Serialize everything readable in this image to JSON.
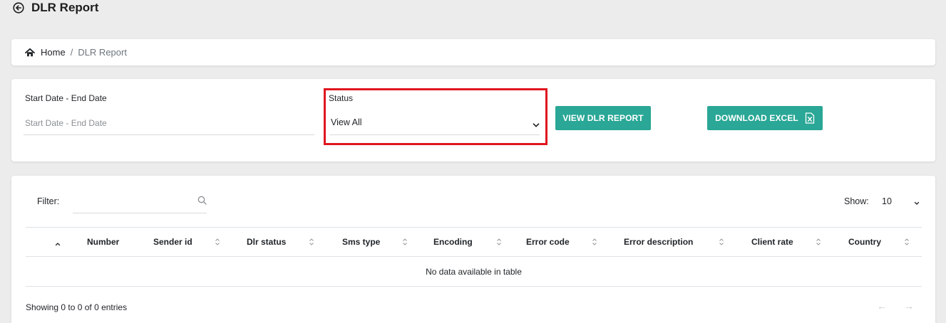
{
  "header": {
    "title": "DLR Report",
    "back_icon": "arrow-circle-left-icon"
  },
  "breadcrumb": {
    "home_icon": "home-icon",
    "home": "Home",
    "separator": "/",
    "current": "DLR Report"
  },
  "filters": {
    "date_label": "Start Date - End Date",
    "date_placeholder": "Start Date - End Date",
    "status_label": "Status",
    "status_value": "View All",
    "view_button": "VIEW DLR REPORT",
    "download_button": "DOWNLOAD EXCEL",
    "download_icon": "excel-file-icon"
  },
  "table": {
    "filter_label": "Filter:",
    "search_icon": "search-icon",
    "show_label": "Show:",
    "show_value": "10",
    "columns": [
      "Number",
      "Sender id",
      "Dlr status",
      "Sms type",
      "Encoding",
      "Error code",
      "Error description",
      "Client rate",
      "Country"
    ],
    "empty_message": "No data available in table",
    "info": "Showing 0 to 0 of 0 entries",
    "prev": "←",
    "next": "→"
  },
  "colors": {
    "accent": "#2aa796",
    "highlight": "#e0161f",
    "background": "#edecec"
  }
}
